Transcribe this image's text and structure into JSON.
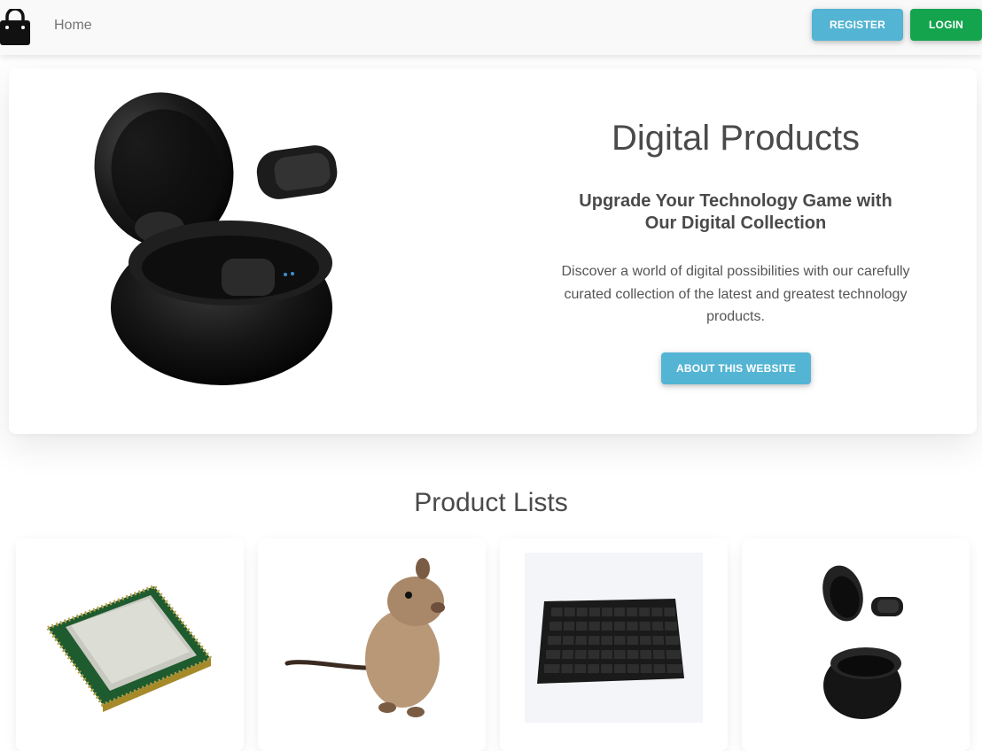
{
  "navbar": {
    "brand_icon": "shopping-bag-icon",
    "home_label": "Home",
    "register_label": "REGISTER",
    "login_label": "LOGIN"
  },
  "hero": {
    "image_icon": "wireless-earbuds-image",
    "title": "Digital Products",
    "subtitle": "Upgrade Your Technology Game with Our Digital Collection",
    "description": "Discover a world of digital possibilities with our carefully curated collection of the latest and greatest technology products.",
    "button_label": "ABOUT THIS WEBSITE"
  },
  "products": {
    "title": "Product Lists",
    "items": [
      {
        "image": "cpu-processor-image"
      },
      {
        "image": "gerbil-mouse-image"
      },
      {
        "image": "mechanical-keyboard-image"
      },
      {
        "image": "wireless-earbuds-image"
      }
    ]
  },
  "colors": {
    "info": "#54b4d3",
    "success": "#14a44d",
    "navbar_bg": "#f9f9f9",
    "text": "#4f4f4f"
  }
}
